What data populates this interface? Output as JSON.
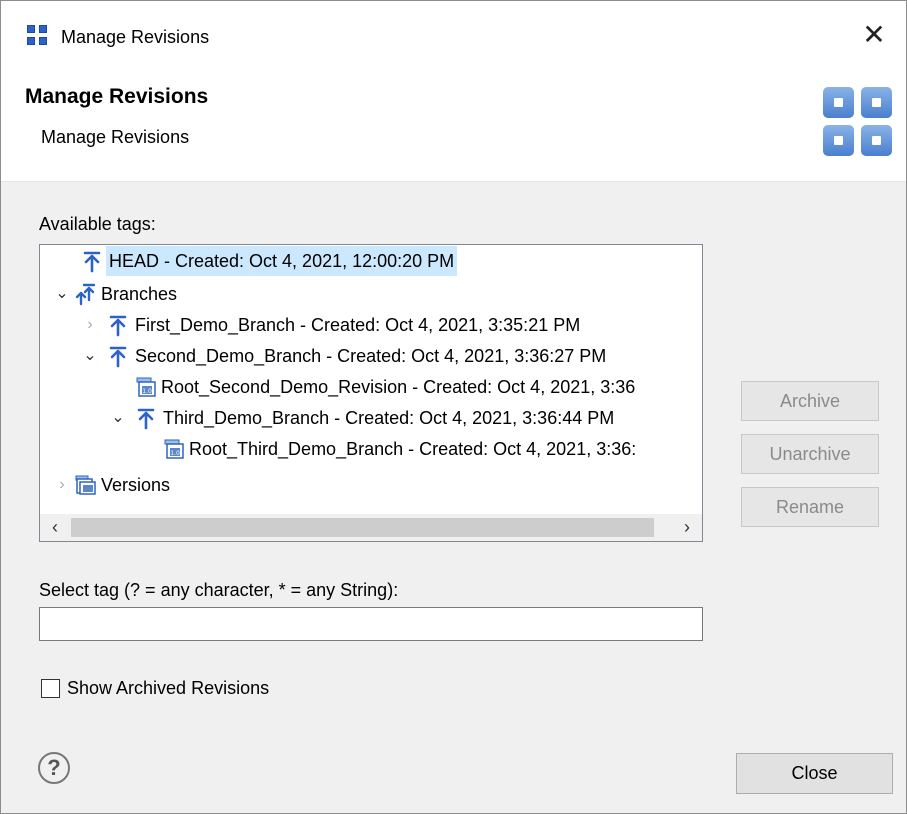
{
  "window": {
    "title": "Manage Revisions",
    "close_glyph": "✕"
  },
  "banner": {
    "title": "Manage Revisions",
    "description": "Manage Revisions"
  },
  "tags": {
    "label": "Available tags:",
    "rows": [
      {
        "label": "HEAD - Created: Oct 4, 2021, 12:00:20 PM",
        "icon": "branch-icon",
        "expander": "none",
        "selected": true
      },
      {
        "label": "Branches",
        "icon": "branches-icon",
        "expander": "expanded"
      },
      {
        "label": "First_Demo_Branch - Created: Oct 4, 2021, 3:35:21 PM",
        "icon": "branch-icon",
        "expander": "collapsed"
      },
      {
        "label": "Second_Demo_Branch - Created: Oct 4, 2021, 3:36:27 PM",
        "icon": "branch-icon",
        "expander": "expanded"
      },
      {
        "label": "Root_Second_Demo_Revision - Created: Oct 4, 2021, 3:36",
        "icon": "version-icon",
        "expander": "none"
      },
      {
        "label": "Third_Demo_Branch - Created: Oct 4, 2021, 3:36:44 PM",
        "icon": "branch-icon",
        "expander": "expanded"
      },
      {
        "label": "Root_Third_Demo_Branch - Created: Oct 4, 2021, 3:36:",
        "icon": "version-icon",
        "expander": "none"
      },
      {
        "label": "Versions",
        "icon": "versions-folder-icon",
        "expander": "collapsed"
      }
    ]
  },
  "actions": {
    "archive": "Archive",
    "unarchive": "Unarchive",
    "rename": "Rename"
  },
  "filter": {
    "label": "Select tag (? = any character, * = any String):",
    "value": ""
  },
  "show_archived": {
    "label": "Show Archived Revisions",
    "checked": false
  },
  "footer": {
    "help_glyph": "?",
    "close": "Close"
  },
  "colors": {
    "selection": "#cce8ff",
    "accent": "#2d62c8"
  }
}
